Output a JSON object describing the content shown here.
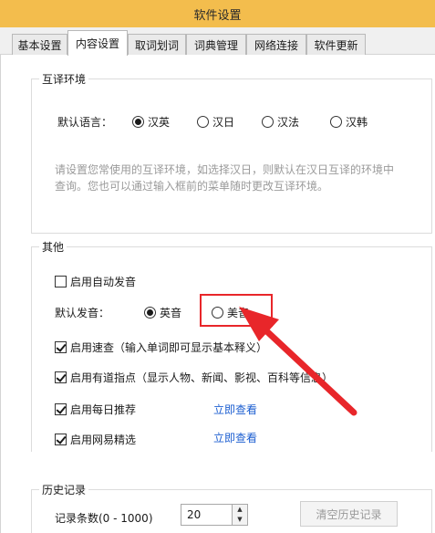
{
  "window": {
    "title": "软件设置"
  },
  "tabs": [
    {
      "label": "基本设置"
    },
    {
      "label": "内容设置",
      "active": true
    },
    {
      "label": "取词划词"
    },
    {
      "label": "词典管理"
    },
    {
      "label": "网络连接"
    },
    {
      "label": "软件更新"
    }
  ],
  "translate_env": {
    "legend": "互译环境",
    "default_lang_label": "默认语言：",
    "options": [
      "汉英",
      "汉日",
      "汉法",
      "汉韩"
    ],
    "selected": "汉英",
    "description": "请设置您常使用的互译环境，如选择汉日，则默认在汉日互译的环境中查询。您也可以通过输入框前的菜单随时更改互译环境。"
  },
  "other": {
    "legend": "其他",
    "auto_pronounce": {
      "label": "启用自动发音",
      "checked": false
    },
    "default_pronounce_label": "默认发音：",
    "pronounce_options": [
      "英音",
      "美音"
    ],
    "pronounce_selected": "英音",
    "quick_lookup": {
      "label": "启用速查（输入单词即可显示基本释义）",
      "checked": true
    },
    "youdao_tips": {
      "label": "启用有道指点（显示人物、新闻、影视、百科等信息）",
      "checked": true
    },
    "daily_recommend": {
      "label": "启用每日推荐",
      "checked": true,
      "link": "立即查看"
    },
    "netease_select": {
      "label": "启用网易精选",
      "checked": true,
      "link": "立即查看"
    }
  },
  "history": {
    "legend": "历史记录",
    "count_label": "记录条数(0 - 1000)",
    "count_value": "20",
    "clear_button": "清空历史记录"
  },
  "colors": {
    "titlebar": "#f3bd4d",
    "annotation_red": "#e8262a",
    "link": "#1d5fd1"
  }
}
